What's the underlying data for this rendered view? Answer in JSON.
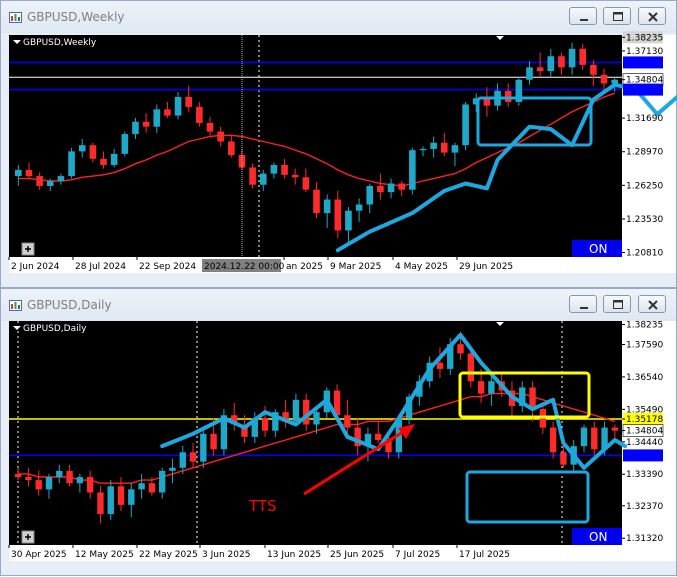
{
  "colors": {
    "bull": "#20a8c8",
    "bear": "#ff2a2a",
    "ma": "#ff2020",
    "blue_line": "#0000ff",
    "tts": "#ff0000",
    "yellow": "#ffff00",
    "cyan": "#1ea8e0",
    "on_bg": "#0000ee",
    "panel": "#ffffff",
    "chart_bg": "#000000"
  },
  "icons": {
    "app": "chart-app-icon",
    "minimize": "minimize-icon",
    "maximize": "maximize-icon",
    "close": "close-icon",
    "plus": "plus-icon"
  },
  "weekly": {
    "window_title": "GBPUSD,Weekly",
    "chart_label": "GBPUSD,Weekly",
    "on_label": "ON",
    "crosshair_date": "2024.12.22 00:00",
    "price_labels": [
      {
        "text": "1.38235",
        "kind": "gray",
        "value": 1.38235
      },
      {
        "text": "1.37130",
        "kind": "plain",
        "value": 1.3713
      },
      {
        "text": "1.34804",
        "kind": "white",
        "value": 1.34804
      },
      {
        "text": "1.31690",
        "kind": "plain",
        "value": 1.3169
      },
      {
        "text": "1.28970",
        "kind": "plain",
        "value": 1.2897
      },
      {
        "text": "1.26250",
        "kind": "plain",
        "value": 1.2625
      },
      {
        "text": "1.23530",
        "kind": "plain",
        "value": 1.2353
      },
      {
        "text": "1.20810",
        "kind": "plain",
        "value": 1.2081
      }
    ],
    "date_labels": [
      "2 Jun 2024",
      "28 Jul 2024",
      "22 Sep 2024",
      "an 2025",
      "9 Mar 2025",
      "4 May 2025",
      "29 Jun 2025"
    ],
    "chart_data": {
      "type": "candlestick",
      "title": "GBPUSD,Weekly",
      "ylim": [
        1.2045,
        1.3842
      ],
      "hlines": [
        {
          "value": 1.362,
          "color": "blue"
        },
        {
          "value": 1.35,
          "color": "white"
        },
        {
          "value": 1.34,
          "color": "blue"
        }
      ],
      "candles": [
        [
          1.27,
          1.279,
          1.262,
          1.275
        ],
        [
          1.275,
          1.281,
          1.268,
          1.27
        ],
        [
          1.27,
          1.273,
          1.259,
          1.262
        ],
        [
          1.262,
          1.268,
          1.258,
          1.266
        ],
        [
          1.266,
          1.272,
          1.263,
          1.27
        ],
        [
          1.27,
          1.293,
          1.268,
          1.29
        ],
        [
          1.29,
          1.3,
          1.285,
          1.295
        ],
        [
          1.295,
          1.297,
          1.281,
          1.284
        ],
        [
          1.284,
          1.29,
          1.276,
          1.279
        ],
        [
          1.279,
          1.292,
          1.277,
          1.288
        ],
        [
          1.288,
          1.306,
          1.286,
          1.304
        ],
        [
          1.304,
          1.317,
          1.3,
          1.314
        ],
        [
          1.314,
          1.321,
          1.305,
          1.31
        ],
        [
          1.31,
          1.328,
          1.305,
          1.324
        ],
        [
          1.324,
          1.33,
          1.317,
          1.319
        ],
        [
          1.319,
          1.338,
          1.316,
          1.334
        ],
        [
          1.334,
          1.343,
          1.322,
          1.326
        ],
        [
          1.326,
          1.33,
          1.31,
          1.313
        ],
        [
          1.313,
          1.318,
          1.303,
          1.306
        ],
        [
          1.306,
          1.31,
          1.294,
          1.298
        ],
        [
          1.298,
          1.303,
          1.285,
          1.287
        ],
        [
          1.287,
          1.292,
          1.275,
          1.277
        ],
        [
          1.277,
          1.28,
          1.26,
          1.263
        ],
        [
          1.263,
          1.275,
          1.258,
          1.272
        ],
        [
          1.272,
          1.281,
          1.268,
          1.279
        ],
        [
          1.279,
          1.284,
          1.268,
          1.271
        ],
        [
          1.271,
          1.276,
          1.263,
          1.269
        ],
        [
          1.269,
          1.276,
          1.257,
          1.259
        ],
        [
          1.259,
          1.265,
          1.236,
          1.24
        ],
        [
          1.24,
          1.255,
          1.228,
          1.251
        ],
        [
          1.251,
          1.258,
          1.22,
          1.226
        ],
        [
          1.226,
          1.245,
          1.215,
          1.242
        ],
        [
          1.242,
          1.252,
          1.233,
          1.247
        ],
        [
          1.247,
          1.264,
          1.24,
          1.262
        ],
        [
          1.262,
          1.272,
          1.251,
          1.257
        ],
        [
          1.257,
          1.268,
          1.252,
          1.264
        ],
        [
          1.264,
          1.266,
          1.254,
          1.259
        ],
        [
          1.259,
          1.293,
          1.255,
          1.291
        ],
        [
          1.291,
          1.294,
          1.286,
          1.292
        ],
        [
          1.292,
          1.302,
          1.285,
          1.297
        ],
        [
          1.297,
          1.305,
          1.286,
          1.289
        ],
        [
          1.289,
          1.297,
          1.278,
          1.295
        ],
        [
          1.295,
          1.33,
          1.291,
          1.328
        ],
        [
          1.328,
          1.337,
          1.322,
          1.333
        ],
        [
          1.333,
          1.342,
          1.318,
          1.327
        ],
        [
          1.327,
          1.345,
          1.323,
          1.339
        ],
        [
          1.339,
          1.345,
          1.326,
          1.33
        ],
        [
          1.33,
          1.349,
          1.327,
          1.348
        ],
        [
          1.348,
          1.363,
          1.344,
          1.358
        ],
        [
          1.358,
          1.37,
          1.35,
          1.355
        ],
        [
          1.355,
          1.373,
          1.35,
          1.367
        ],
        [
          1.367,
          1.37,
          1.352,
          1.358
        ],
        [
          1.358,
          1.378,
          1.352,
          1.373
        ],
        [
          1.373,
          1.377,
          1.356,
          1.36
        ],
        [
          1.36,
          1.364,
          1.343,
          1.352
        ],
        [
          1.352,
          1.357,
          1.34,
          1.345
        ],
        [
          1.345,
          1.35,
          1.338,
          1.348
        ]
      ],
      "ma": [
        1.268,
        1.268,
        1.267,
        1.266,
        1.266,
        1.267,
        1.269,
        1.27,
        1.271,
        1.273,
        1.276,
        1.28,
        1.283,
        1.287,
        1.29,
        1.294,
        1.298,
        1.3,
        1.302,
        1.303,
        1.303,
        1.302,
        1.3,
        1.298,
        1.296,
        1.294,
        1.291,
        1.288,
        1.284,
        1.28,
        1.275,
        1.271,
        1.268,
        1.266,
        1.264,
        1.263,
        1.262,
        1.264,
        1.266,
        1.268,
        1.27,
        1.272,
        1.276,
        1.281,
        1.285,
        1.289,
        1.293,
        1.297,
        1.302,
        1.307,
        1.312,
        1.317,
        1.322,
        1.326,
        1.33,
        1.334,
        1.337
      ],
      "trace": [
        [
          30,
          1.21
        ],
        [
          33,
          1.225
        ],
        [
          37,
          1.24
        ],
        [
          40,
          1.258
        ],
        [
          42,
          1.264
        ],
        [
          44,
          1.26
        ],
        [
          45,
          1.283
        ],
        [
          48,
          1.31
        ],
        [
          50,
          1.308
        ],
        [
          52,
          1.295
        ],
        [
          54,
          1.332
        ],
        [
          56,
          1.344
        ],
        [
          58,
          1.34
        ],
        [
          60,
          1.32
        ],
        [
          62,
          1.335
        ],
        [
          64,
          1.36
        ],
        [
          66,
          1.355
        ],
        [
          68,
          1.38
        ],
        [
          70,
          1.36
        ],
        [
          72,
          1.35
        ],
        [
          74,
          1.368
        ],
        [
          76,
          1.345
        ]
      ]
    }
  },
  "daily": {
    "window_title": "GBPUSD,Daily",
    "chart_label": "GBPUSD,Daily",
    "on_label": "ON",
    "tts_label": "TTS",
    "price_labels": [
      {
        "text": "1.38235",
        "kind": "plain",
        "value": 1.38235
      },
      {
        "text": "1.37590",
        "kind": "plain",
        "value": 1.3759
      },
      {
        "text": "1.36540",
        "kind": "plain",
        "value": 1.3654
      },
      {
        "text": "1.35490",
        "kind": "plain",
        "value": 1.3549
      },
      {
        "text": "1.35178",
        "kind": "yellow",
        "value": 1.35178
      },
      {
        "text": "1.34804",
        "kind": "white",
        "value": 1.34804
      },
      {
        "text": "1.34440",
        "kind": "plain",
        "value": 1.3444
      },
      {
        "text": "1.33390",
        "kind": "plain",
        "value": 1.3339
      },
      {
        "text": "1.32370",
        "kind": "plain",
        "value": 1.3237
      },
      {
        "text": "1.31320",
        "kind": "plain",
        "value": 1.3132
      }
    ],
    "date_labels": [
      "30 Apr 2025",
      "12 May 2025",
      "22 May 2025",
      "3 Jun 2025",
      "13 Jun 2025",
      "25 Jun 2025",
      "7 Jul 2025",
      "17 Jul 2025"
    ],
    "chart_data": {
      "type": "candlestick",
      "title": "GBPUSD,Daily",
      "ylim": [
        1.311,
        1.3835
      ],
      "hlines": [
        {
          "value": 1.35178,
          "color": "yellow"
        },
        {
          "value": 1.34,
          "color": "blue"
        }
      ],
      "candles": [
        [
          1.334,
          1.336,
          1.332,
          1.333
        ],
        [
          1.333,
          1.336,
          1.33,
          1.332
        ],
        [
          1.332,
          1.335,
          1.327,
          1.329
        ],
        [
          1.329,
          1.334,
          1.326,
          1.333
        ],
        [
          1.333,
          1.337,
          1.331,
          1.335
        ],
        [
          1.335,
          1.337,
          1.33,
          1.331
        ],
        [
          1.331,
          1.334,
          1.328,
          1.333
        ],
        [
          1.333,
          1.335,
          1.326,
          1.328
        ],
        [
          1.328,
          1.33,
          1.318,
          1.321
        ],
        [
          1.321,
          1.332,
          1.319,
          1.33
        ],
        [
          1.33,
          1.333,
          1.322,
          1.324
        ],
        [
          1.324,
          1.331,
          1.32,
          1.329
        ],
        [
          1.329,
          1.334,
          1.326,
          1.331
        ],
        [
          1.331,
          1.333,
          1.327,
          1.328
        ],
        [
          1.328,
          1.336,
          1.326,
          1.335
        ],
        [
          1.335,
          1.339,
          1.331,
          1.336
        ],
        [
          1.336,
          1.343,
          1.334,
          1.341
        ],
        [
          1.341,
          1.344,
          1.336,
          1.338
        ],
        [
          1.338,
          1.348,
          1.336,
          1.347
        ],
        [
          1.347,
          1.352,
          1.34,
          1.342
        ],
        [
          1.342,
          1.355,
          1.34,
          1.353
        ],
        [
          1.353,
          1.357,
          1.348,
          1.35
        ],
        [
          1.35,
          1.353,
          1.344,
          1.346
        ],
        [
          1.346,
          1.354,
          1.344,
          1.352
        ],
        [
          1.352,
          1.356,
          1.346,
          1.348
        ],
        [
          1.348,
          1.355,
          1.346,
          1.354
        ],
        [
          1.354,
          1.358,
          1.349,
          1.351
        ],
        [
          1.351,
          1.36,
          1.35,
          1.358
        ],
        [
          1.358,
          1.36,
          1.348,
          1.35
        ],
        [
          1.35,
          1.356,
          1.347,
          1.354
        ],
        [
          1.354,
          1.362,
          1.352,
          1.361
        ],
        [
          1.361,
          1.363,
          1.351,
          1.353
        ],
        [
          1.353,
          1.358,
          1.347,
          1.349
        ],
        [
          1.349,
          1.352,
          1.34,
          1.343
        ],
        [
          1.343,
          1.349,
          1.338,
          1.347
        ],
        [
          1.347,
          1.351,
          1.344,
          1.345
        ],
        [
          1.345,
          1.348,
          1.339,
          1.341
        ],
        [
          1.341,
          1.353,
          1.339,
          1.352
        ],
        [
          1.352,
          1.36,
          1.35,
          1.359
        ],
        [
          1.359,
          1.366,
          1.356,
          1.364
        ],
        [
          1.364,
          1.372,
          1.362,
          1.37
        ],
        [
          1.37,
          1.375,
          1.365,
          1.368
        ],
        [
          1.368,
          1.378,
          1.366,
          1.376
        ],
        [
          1.376,
          1.38,
          1.371,
          1.373
        ],
        [
          1.373,
          1.375,
          1.362,
          1.364
        ],
        [
          1.364,
          1.368,
          1.357,
          1.36
        ],
        [
          1.36,
          1.366,
          1.356,
          1.364
        ],
        [
          1.364,
          1.367,
          1.359,
          1.361
        ],
        [
          1.361,
          1.364,
          1.352,
          1.356
        ],
        [
          1.356,
          1.364,
          1.354,
          1.362
        ],
        [
          1.362,
          1.364,
          1.351,
          1.355
        ],
        [
          1.355,
          1.357,
          1.347,
          1.349
        ],
        [
          1.349,
          1.351,
          1.339,
          1.341
        ],
        [
          1.341,
          1.344,
          1.336,
          1.337
        ],
        [
          1.337,
          1.345,
          1.335,
          1.343
        ],
        [
          1.343,
          1.35,
          1.341,
          1.349
        ],
        [
          1.349,
          1.351,
          1.34,
          1.342
        ],
        [
          1.342,
          1.351,
          1.34,
          1.349
        ],
        [
          1.349,
          1.35,
          1.345,
          1.348
        ]
      ],
      "ma": [
        1.334,
        1.334,
        1.333,
        1.333,
        1.333,
        1.333,
        1.332,
        1.332,
        1.331,
        1.331,
        1.331,
        1.331,
        1.332,
        1.332,
        1.333,
        1.334,
        1.335,
        1.336,
        1.337,
        1.338,
        1.339,
        1.34,
        1.341,
        1.342,
        1.343,
        1.344,
        1.345,
        1.346,
        1.347,
        1.348,
        1.349,
        1.35,
        1.35,
        1.35,
        1.351,
        1.351,
        1.351,
        1.352,
        1.353,
        1.354,
        1.355,
        1.356,
        1.357,
        1.358,
        1.359,
        1.359,
        1.36,
        1.36,
        1.36,
        1.36,
        1.359,
        1.358,
        1.357,
        1.356,
        1.355,
        1.354,
        1.353,
        1.352,
        1.351
      ],
      "trace": [
        [
          14,
          1.343
        ],
        [
          17,
          1.347
        ],
        [
          20,
          1.352
        ],
        [
          22,
          1.349
        ],
        [
          24,
          1.354
        ],
        [
          27,
          1.35
        ],
        [
          30,
          1.358
        ],
        [
          32,
          1.346
        ],
        [
          35,
          1.342
        ],
        [
          37,
          1.352
        ],
        [
          40,
          1.368
        ],
        [
          43,
          1.379
        ],
        [
          45,
          1.37
        ],
        [
          48,
          1.359
        ],
        [
          50,
          1.355
        ],
        [
          52,
          1.358
        ],
        [
          53,
          1.344
        ],
        [
          55,
          1.336
        ],
        [
          57,
          1.342
        ],
        [
          58,
          1.345
        ],
        [
          59,
          1.343
        ]
      ]
    }
  }
}
